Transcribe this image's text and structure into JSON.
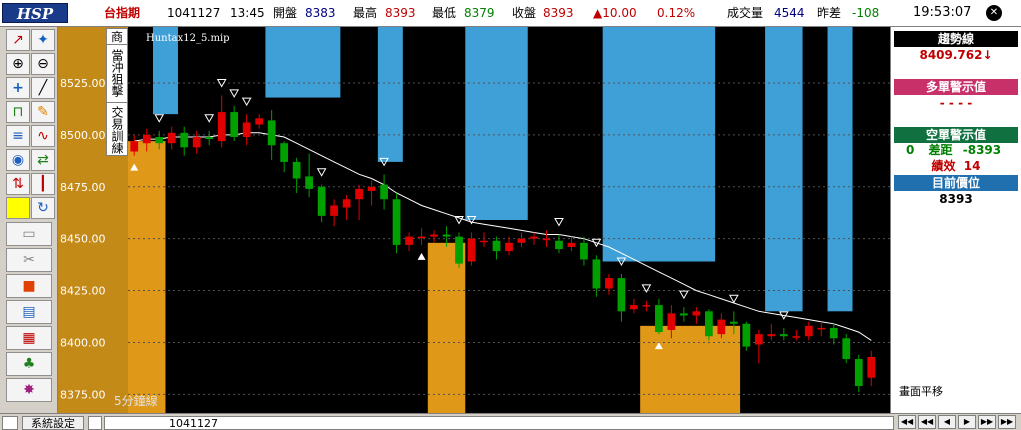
{
  "header": {
    "logo": "HSP",
    "symbol": "台指期",
    "date": "1041127",
    "time": "13:45",
    "open_label": "開盤",
    "open_value": "8383",
    "high_label": "最高",
    "high_value": "8393",
    "low_label": "最低",
    "low_value": "8379",
    "close_label": "收盤",
    "close_value": "8393",
    "change": "▲10.00",
    "change_pct": "0.12%",
    "volume_label": "成交量",
    "volume_value": "4544",
    "diff_label": "昨差",
    "diff_value": "-108",
    "clock": "19:53:07",
    "close_glyph": "✕",
    "colors": {
      "up": "#e00000",
      "down": "#008000",
      "volume": "#000080",
      "logo_bg": "#1a3a8a"
    }
  },
  "toolbar": {
    "icons": [
      "trend-line-icon",
      "magic-wand-icon",
      "zoom-in-icon",
      "zoom-out-icon",
      "crosshair-icon",
      "diagonal-line-icon",
      "unlock-icon",
      "edit-pencil-icon",
      "fibonacci-icon",
      "wave-icon",
      "indicator-icon",
      "swap-icon",
      "arrows-icon",
      "candles-icon",
      "yellow-block-icon",
      "refresh-icon",
      "folder-icon",
      "scissors-icon",
      "stop-square-icon",
      "window-icon",
      "grid-chart-icon",
      "shake-hands-icon",
      "splash-icon"
    ]
  },
  "side_tabs": {
    "tab_1": "商",
    "tab_2": "當沖狙擊",
    "tab_3": "交易訓練"
  },
  "chart": {
    "file_name": "Huntax12_5.mip",
    "timeframe_label": "5分鐘線",
    "colors": {
      "background": "#000000",
      "blue_zone": "#3fa0d8",
      "orange_zone": "#e09818",
      "ma_line": "#ffffff",
      "axis_bg": "#c48a18",
      "up_candle": "#e00000",
      "down_candle": "#00a000"
    }
  },
  "chart_data": {
    "type": "candlestick",
    "y_ticks": [
      8525,
      8500,
      8475,
      8450,
      8425,
      8400,
      8375
    ],
    "y_tick_labels": [
      "8525.00",
      "8500.00",
      "8475.00",
      "8450.00",
      "8425.00",
      "8400.00",
      "8375.00"
    ],
    "ylim": [
      8366,
      8552
    ],
    "num_bars": 60,
    "grid": true,
    "candles": [
      {
        "o": 8492,
        "c": 8497,
        "h": 8500,
        "l": 8490
      },
      {
        "o": 8496,
        "c": 8500,
        "h": 8503,
        "l": 8492
      },
      {
        "o": 8499,
        "c": 8496,
        "h": 8502,
        "l": 8493
      },
      {
        "o": 8496,
        "c": 8501,
        "h": 8504,
        "l": 8493
      },
      {
        "o": 8501,
        "c": 8494,
        "h": 8504,
        "l": 8490
      },
      {
        "o": 8494,
        "c": 8499,
        "h": 8502,
        "l": 8491
      },
      {
        "o": 8499,
        "c": 8498,
        "h": 8502,
        "l": 8495
      },
      {
        "o": 8497,
        "c": 8511,
        "h": 8519,
        "l": 8494
      },
      {
        "o": 8511,
        "c": 8499,
        "h": 8514,
        "l": 8497
      },
      {
        "o": 8499,
        "c": 8506,
        "h": 8510,
        "l": 8495
      },
      {
        "o": 8505,
        "c": 8508,
        "h": 8510,
        "l": 8503
      },
      {
        "o": 8507,
        "c": 8495,
        "h": 8512,
        "l": 8488
      },
      {
        "o": 8496,
        "c": 8487,
        "h": 8497,
        "l": 8482
      },
      {
        "o": 8487,
        "c": 8479,
        "h": 8489,
        "l": 8472
      },
      {
        "o": 8480,
        "c": 8474,
        "h": 8491,
        "l": 8470
      },
      {
        "o": 8475,
        "c": 8461,
        "h": 8476,
        "l": 8458
      },
      {
        "o": 8461,
        "c": 8466,
        "h": 8469,
        "l": 8456
      },
      {
        "o": 8465,
        "c": 8469,
        "h": 8471,
        "l": 8459
      },
      {
        "o": 8469,
        "c": 8474,
        "h": 8476,
        "l": 8459
      },
      {
        "o": 8473,
        "c": 8475,
        "h": 8478,
        "l": 8466
      },
      {
        "o": 8476,
        "c": 8469,
        "h": 8481,
        "l": 8464
      },
      {
        "o": 8469,
        "c": 8447,
        "h": 8472,
        "l": 8443
      },
      {
        "o": 8447,
        "c": 8451,
        "h": 8453,
        "l": 8444
      },
      {
        "o": 8451,
        "c": 8451,
        "h": 8455,
        "l": 8447
      },
      {
        "o": 8451,
        "c": 8452,
        "h": 8454,
        "l": 8448
      },
      {
        "o": 8452,
        "c": 8451,
        "h": 8456,
        "l": 8446
      },
      {
        "o": 8451,
        "c": 8438,
        "h": 8453,
        "l": 8436
      },
      {
        "o": 8439,
        "c": 8450,
        "h": 8453,
        "l": 8437
      },
      {
        "o": 8449,
        "c": 8449,
        "h": 8453,
        "l": 8446
      },
      {
        "o": 8449,
        "c": 8444,
        "h": 8451,
        "l": 8440
      },
      {
        "o": 8444,
        "c": 8448,
        "h": 8451,
        "l": 8442
      },
      {
        "o": 8448,
        "c": 8450,
        "h": 8453,
        "l": 8446
      },
      {
        "o": 8450,
        "c": 8451,
        "h": 8453,
        "l": 8447
      },
      {
        "o": 8450,
        "c": 8450,
        "h": 8454,
        "l": 8446
      },
      {
        "o": 8449,
        "c": 8445,
        "h": 8452,
        "l": 8443
      },
      {
        "o": 8446,
        "c": 8448,
        "h": 8451,
        "l": 8444
      },
      {
        "o": 8448,
        "c": 8440,
        "h": 8451,
        "l": 8437
      },
      {
        "o": 8440,
        "c": 8426,
        "h": 8442,
        "l": 8422
      },
      {
        "o": 8426,
        "c": 8431,
        "h": 8433,
        "l": 8423
      },
      {
        "o": 8431,
        "c": 8415,
        "h": 8433,
        "l": 8410
      },
      {
        "o": 8416,
        "c": 8418,
        "h": 8421,
        "l": 8414
      },
      {
        "o": 8418,
        "c": 8418,
        "h": 8420,
        "l": 8415
      },
      {
        "o": 8418,
        "c": 8405,
        "h": 8421,
        "l": 8404
      },
      {
        "o": 8406,
        "c": 8414,
        "h": 8418,
        "l": 8402
      },
      {
        "o": 8414,
        "c": 8413,
        "h": 8417,
        "l": 8410
      },
      {
        "o": 8413,
        "c": 8415,
        "h": 8417,
        "l": 8409
      },
      {
        "o": 8415,
        "c": 8403,
        "h": 8416,
        "l": 8401
      },
      {
        "o": 8404,
        "c": 8411,
        "h": 8414,
        "l": 8402
      },
      {
        "o": 8410,
        "c": 8409,
        "h": 8415,
        "l": 8404
      },
      {
        "o": 8409,
        "c": 8398,
        "h": 8410,
        "l": 8396
      },
      {
        "o": 8399,
        "c": 8404,
        "h": 8406,
        "l": 8390
      },
      {
        "o": 8403,
        "c": 8404,
        "h": 8409,
        "l": 8401
      },
      {
        "o": 8404,
        "c": 8403,
        "h": 8407,
        "l": 8401
      },
      {
        "o": 8403,
        "c": 8403,
        "h": 8406,
        "l": 8401
      },
      {
        "o": 8403,
        "c": 8408,
        "h": 8410,
        "l": 8401
      },
      {
        "o": 8407,
        "c": 8407,
        "h": 8410,
        "l": 8403
      },
      {
        "o": 8407,
        "c": 8402,
        "h": 8409,
        "l": 8399
      },
      {
        "o": 8402,
        "c": 8392,
        "h": 8404,
        "l": 8390
      },
      {
        "o": 8392,
        "c": 8379,
        "h": 8394,
        "l": 8376
      },
      {
        "o": 8383,
        "c": 8393,
        "h": 8396,
        "l": 8379
      }
    ],
    "ma": [
      8497,
      8498,
      8498,
      8499,
      8499,
      8499,
      8499,
      8500,
      8500,
      8501,
      8501,
      8500,
      8499,
      8496,
      8493,
      8490,
      8487,
      8484,
      8481,
      8479,
      8476,
      8472,
      8469,
      8466,
      8464,
      8462,
      8460,
      8458,
      8457,
      8456,
      8455,
      8454,
      8453,
      8452,
      8452,
      8451,
      8450,
      8448,
      8446,
      8443,
      8440,
      8437,
      8434,
      8431,
      8428,
      8425,
      8423,
      8421,
      8419,
      8417,
      8415,
      8414,
      8413,
      8412,
      8411,
      8410,
      8409,
      8407,
      8405,
      8401
    ],
    "blue_zones": [
      [
        2,
        3
      ],
      [
        11,
        16
      ],
      [
        20,
        21
      ],
      [
        27,
        31
      ],
      [
        38,
        46
      ],
      [
        51,
        53
      ],
      [
        56,
        57
      ]
    ],
    "orange_zones": [
      [
        0,
        2
      ],
      [
        24,
        26
      ],
      [
        41,
        48
      ]
    ],
    "orange_levels": [
      8497,
      8448,
      8408
    ],
    "up_markers": [
      0,
      23,
      42
    ],
    "down_markers": [
      2,
      6,
      7,
      8,
      9,
      15,
      20,
      26,
      27,
      34,
      37,
      39,
      41,
      44,
      48,
      52
    ],
    "plot_right_bar": 61
  },
  "right_panel": {
    "trend_label": "趨勢線",
    "trend_value": "8409.762↓",
    "long_label": "多單警示值",
    "long_value": "- - - -",
    "short_label": "空單警示值",
    "short_qty": "0",
    "short_diff_label": "差距",
    "short_diff_value": "-8393",
    "perf_label": "績效",
    "perf_value": "14",
    "position_label": "目前價位",
    "position_value": "8393",
    "pan_label": "畫面平移",
    "colors": {
      "trend_bg": "#000000",
      "long_bg": "#c8306a",
      "short_bg": "#107040",
      "pos_bg": "#2070b0",
      "red_text": "#c00000",
      "green_text": "#008000"
    }
  },
  "status": {
    "system_label": "系統設定",
    "date": "1041127",
    "nav_labels": [
      "◀◀",
      "◀◀",
      "◀",
      "▶",
      "▶▶",
      "▶▶"
    ]
  }
}
